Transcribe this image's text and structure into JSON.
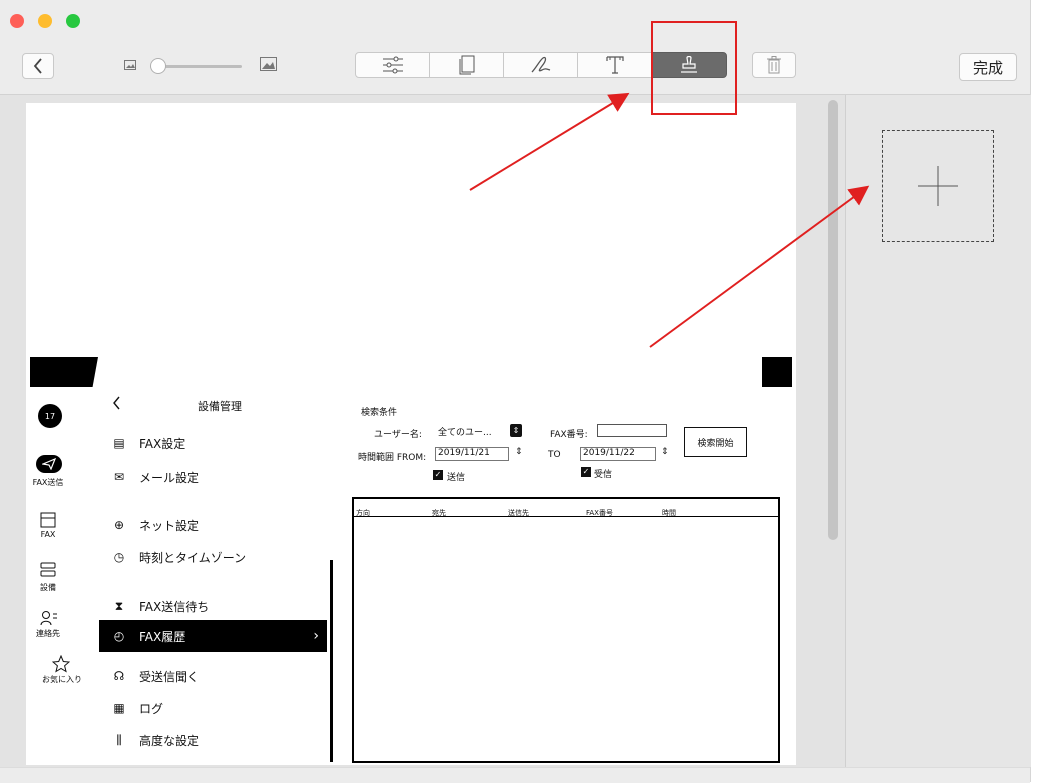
{
  "toolbar": {
    "back_icon": "chevron-left-icon",
    "done_label": "完成",
    "tools": [
      "adjust-icon",
      "pages-icon",
      "signature-icon",
      "text-icon",
      "stamp-icon",
      "trash-icon"
    ]
  },
  "document": {
    "sidebar": {
      "badge": "17",
      "nav": [
        {
          "label": "FAX送信",
          "icon": "send-icon"
        },
        {
          "label": "FAX",
          "icon": "fax-icon"
        },
        {
          "label": "設備",
          "icon": "device-icon"
        },
        {
          "label": "連絡先",
          "icon": "contacts-icon"
        },
        {
          "label": "お気に入り",
          "icon": "star-icon"
        }
      ]
    },
    "menu": {
      "title": "設備管理",
      "items": [
        {
          "label": "FAX設定"
        },
        {
          "label": "メール設定"
        },
        {
          "label": "ネット設定"
        },
        {
          "label": "時刻とタイムゾーン"
        },
        {
          "label": "FAX送信待ち"
        },
        {
          "label": "FAX履歴",
          "selected": true
        },
        {
          "label": "受送信聞く"
        },
        {
          "label": "ログ"
        },
        {
          "label": "高度な設定"
        }
      ]
    },
    "search": {
      "title": "検索条件",
      "user_label": "ユーザー名:",
      "user_value": "全てのユー...",
      "fax_label": "FAX番号:",
      "fax_value": "",
      "range_label": "時間範囲 FROM:",
      "from_value": "2019/11/21",
      "to_label": "TO",
      "to_value": "2019/11/22",
      "send_label": "送信",
      "receive_label": "受信",
      "search_button": "検索開始"
    },
    "table": {
      "headers": [
        "方向",
        "宛先",
        "送信先",
        "FAX番号",
        "時間"
      ]
    }
  },
  "colors": {
    "highlight": "#e02020",
    "selected_tool": "#6b6b6b",
    "menu_selected": "#000000"
  }
}
